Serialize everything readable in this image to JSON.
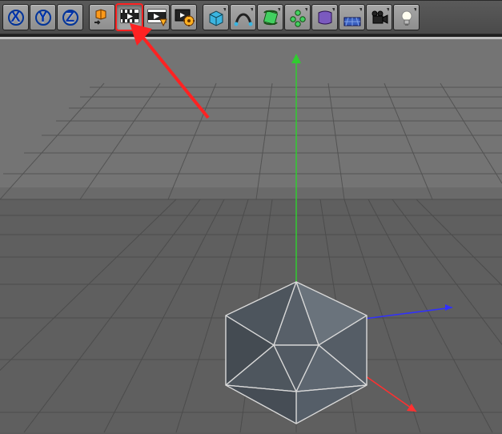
{
  "toolbar": {
    "x_label": "X",
    "y_label": "Y",
    "z_label": "Z"
  },
  "annotation": {
    "arrow_color": "#ff2222"
  },
  "colors": {
    "axis_x": "#ff3030",
    "axis_y": "#30cc30",
    "axis_z": "#3030ff"
  }
}
